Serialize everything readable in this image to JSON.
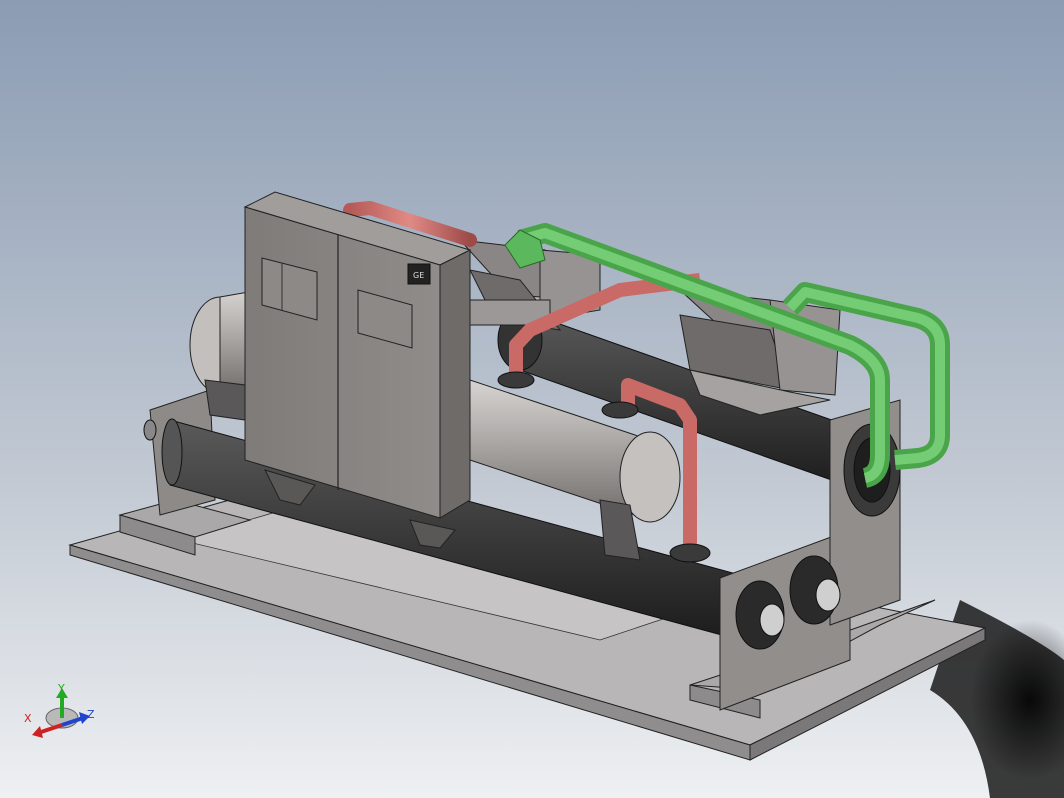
{
  "viewport": {
    "background_top": "#8b9cb3",
    "background_bottom": "#e9ecef"
  },
  "model": {
    "sheet_metal": "#9a9694",
    "base_plate": "#a9a7a7",
    "cabinet": "#8a8684",
    "vessel_light": "#b3b0ae",
    "vessel_dark": "#3d3d3d",
    "pipe_red": "#c96a66",
    "pipe_green": "#5cb85c",
    "cabinet_emblem_text": "GE"
  },
  "triad": {
    "x_label": "X",
    "y_label": "Y",
    "z_label": "Z",
    "x_color": "#cc2222",
    "y_color": "#22aa22",
    "z_color": "#2244cc"
  }
}
